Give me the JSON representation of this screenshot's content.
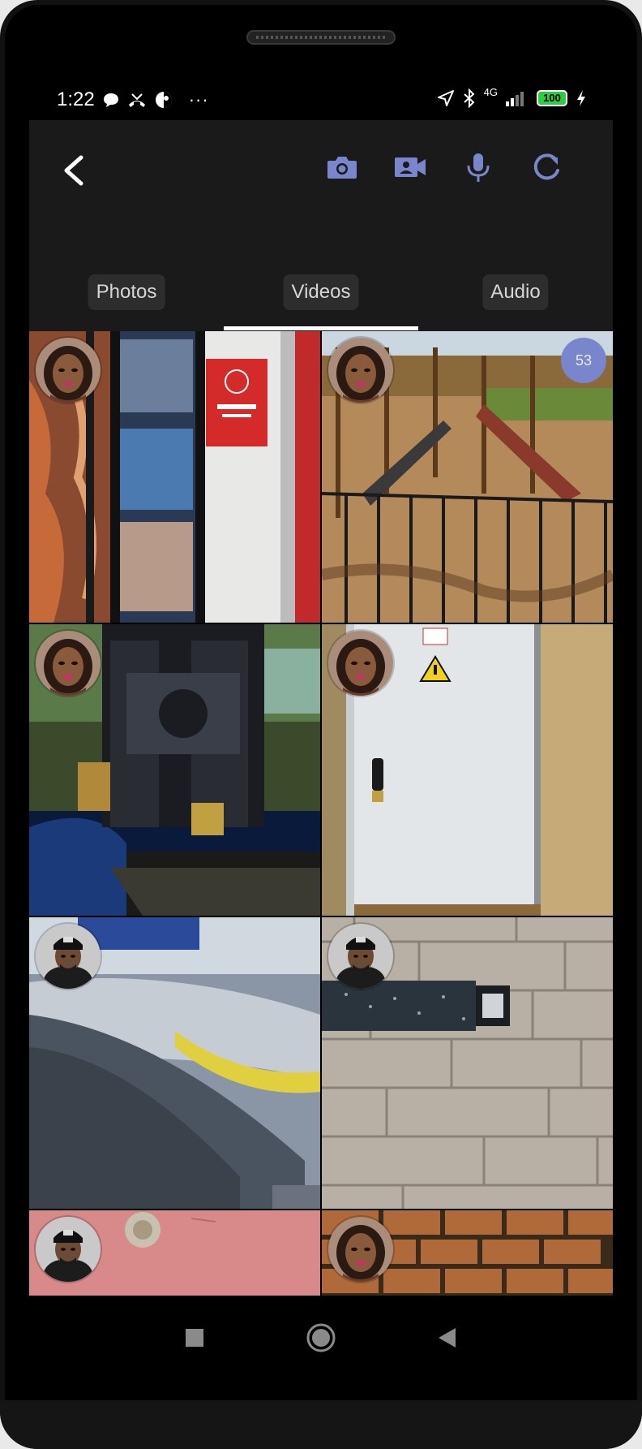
{
  "status_bar": {
    "time": "1:22",
    "left_icons": [
      "chat-bubble-icon",
      "missed-call-icon",
      "app-circle-icon"
    ],
    "overflow": "···",
    "network": "4G",
    "battery": "100"
  },
  "toolbar": {
    "actions": [
      "camera-icon",
      "video-camera-icon",
      "microphone-icon",
      "refresh-icon"
    ],
    "accent_color": "#7986cb"
  },
  "tabs": [
    {
      "label": "Photos",
      "selected": false
    },
    {
      "label": "Videos",
      "selected": true
    },
    {
      "label": "Audio",
      "selected": false
    }
  ],
  "grid": {
    "count_badge": "53",
    "tiles": [
      {
        "avatar": "woman",
        "scene": "shop-door"
      },
      {
        "avatar": "woman",
        "scene": "playground"
      },
      {
        "avatar": "woman",
        "scene": "machinery"
      },
      {
        "avatar": "woman",
        "scene": "electrical-cabinet"
      },
      {
        "avatar": "man",
        "scene": "car-interior"
      },
      {
        "avatar": "man",
        "scene": "paving-drain"
      },
      {
        "avatar": "man",
        "scene": "red-panel"
      },
      {
        "avatar": "woman",
        "scene": "brick-wall"
      }
    ]
  },
  "nav_bar": [
    "recent-apps-icon",
    "home-icon",
    "back-icon"
  ]
}
